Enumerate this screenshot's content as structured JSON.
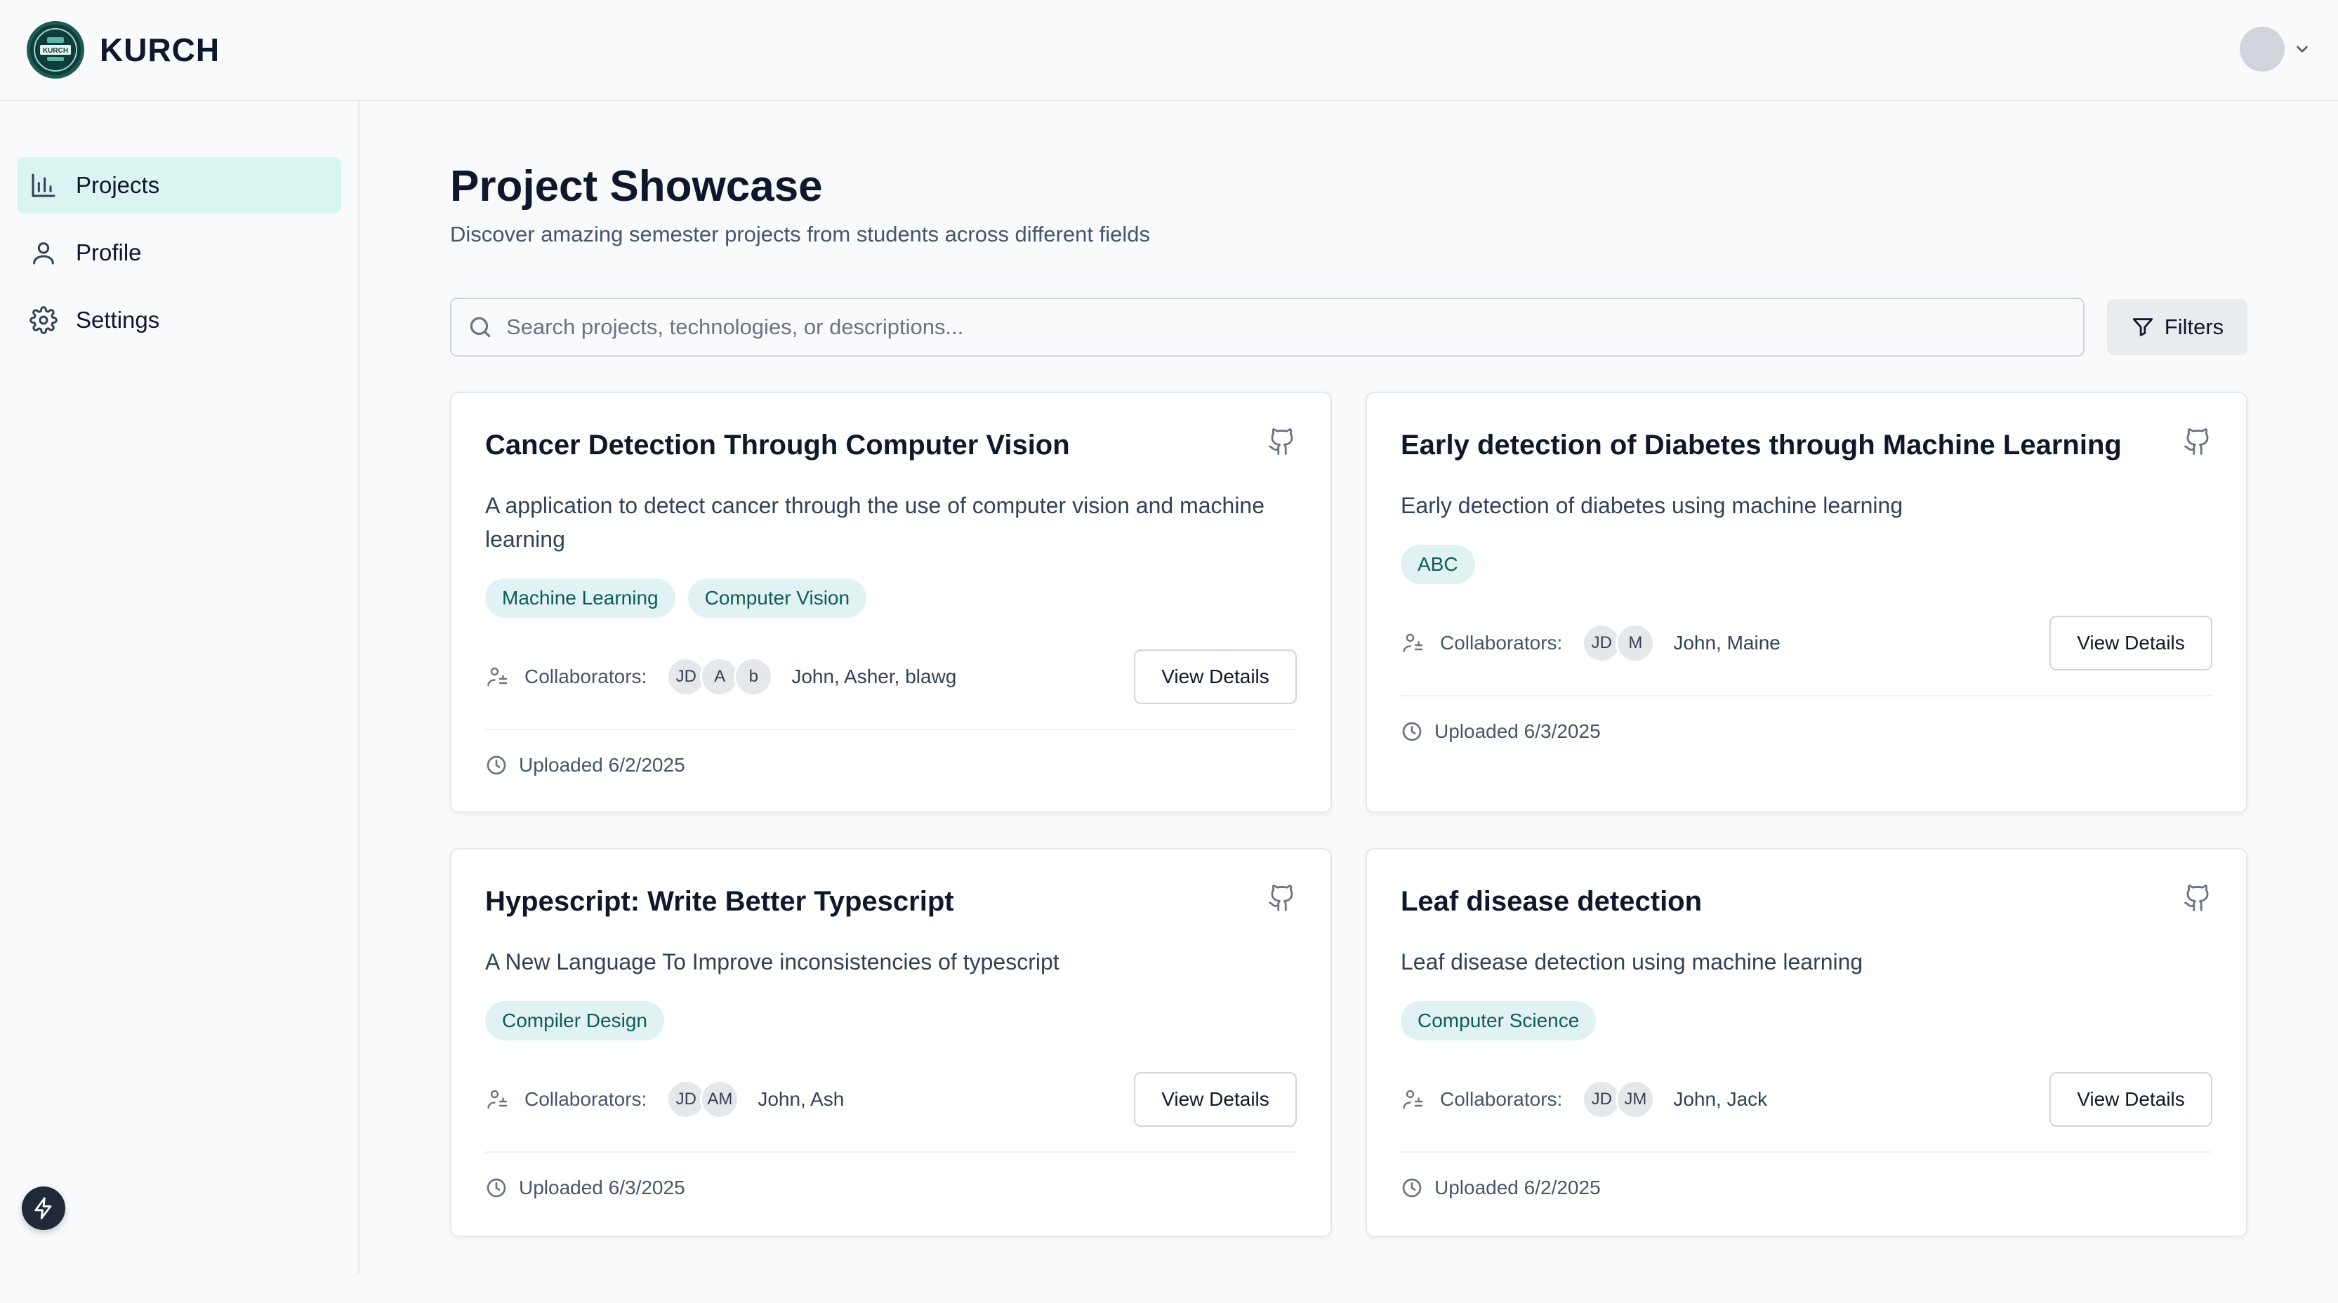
{
  "app": {
    "name": "KURCH",
    "logo_text": "KURCH"
  },
  "sidebar": {
    "items": [
      {
        "label": "Projects",
        "icon": "bar-chart-icon",
        "active": true
      },
      {
        "label": "Profile",
        "icon": "user-icon",
        "active": false
      },
      {
        "label": "Settings",
        "icon": "gear-icon",
        "active": false
      }
    ]
  },
  "page": {
    "title": "Project Showcase",
    "subtitle": "Discover amazing semester projects from students across different fields"
  },
  "search": {
    "placeholder": "Search projects, technologies, or descriptions...",
    "value": ""
  },
  "filters_label": "Filters",
  "collaborators_label": "Collaborators:",
  "view_details_label": "View Details",
  "colors": {
    "accent_bg": "#d9f4f1",
    "tag_bg": "#e0f2f1",
    "tag_text": "#0f5c56"
  },
  "projects": [
    {
      "title": "Cancer Detection Through Computer Vision",
      "description": "A application to detect cancer through the use of computer vision and machine learning",
      "tags": [
        "Machine Learning",
        "Computer Vision"
      ],
      "avatars": [
        "JD",
        "A",
        "b"
      ],
      "collaborators": "John, Asher, blawg",
      "uploaded": "Uploaded 6/2/2025"
    },
    {
      "title": "Early detection of Diabetes through Machine Learning",
      "description": "Early detection of diabetes using machine learning",
      "tags": [
        "ABC"
      ],
      "avatars": [
        "JD",
        "M"
      ],
      "collaborators": "John, Maine",
      "uploaded": "Uploaded 6/3/2025"
    },
    {
      "title": "Hypescript: Write Better Typescript",
      "description": "A New Language To Improve inconsistencies of typescript",
      "tags": [
        "Compiler Design"
      ],
      "avatars": [
        "JD",
        "AM"
      ],
      "collaborators": "John, Ash",
      "uploaded": "Uploaded 6/3/2025"
    },
    {
      "title": "Leaf disease detection",
      "description": "Leaf disease detection using machine learning",
      "tags": [
        "Computer Science"
      ],
      "avatars": [
        "JD",
        "JM"
      ],
      "collaborators": "John, Jack",
      "uploaded": "Uploaded 6/2/2025"
    }
  ]
}
